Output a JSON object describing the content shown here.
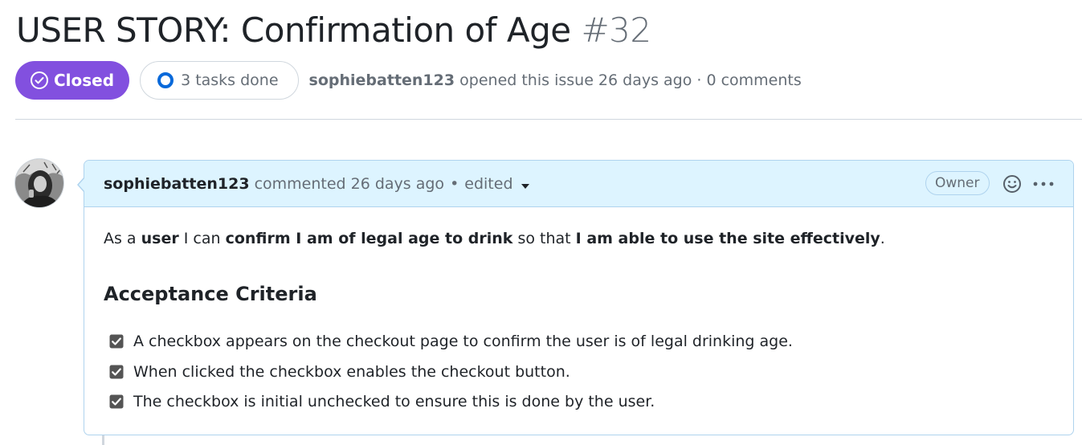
{
  "issue": {
    "title": "USER STORY: Confirmation of Age",
    "number": "#32",
    "state": "Closed",
    "state_color": "#8250df",
    "tasks": "3 tasks done",
    "author": "sophiebatten123",
    "opened_text": "opened this issue 26 days ago · 0 comments"
  },
  "comment": {
    "author": "sophiebatten123",
    "action": "commented 26 days ago",
    "separator": "•",
    "edited": "edited",
    "owner_badge": "Owner",
    "body": {
      "p1": "As a ",
      "b1": "user",
      "p2": " I can ",
      "b2": "confirm I am of legal age to drink",
      "p3": " so that ",
      "b3": "I am able to use the site effectively",
      "p4": "."
    },
    "heading": "Acceptance Criteria",
    "tasks": [
      {
        "text": "A checkbox appears on the checkout page to confirm the user is of legal drinking age.",
        "checked": true
      },
      {
        "text": "When clicked the checkbox enables the checkout button.",
        "checked": true
      },
      {
        "text": "The checkbox is initial unchecked to ensure this is done by the user.",
        "checked": true
      }
    ]
  },
  "icons": {
    "state": "check-circle-icon",
    "tasks": "progress-ring-icon",
    "reaction": "smiley-icon",
    "more": "kebab-horizontal-icon",
    "edit_menu": "triangle-down-icon"
  }
}
